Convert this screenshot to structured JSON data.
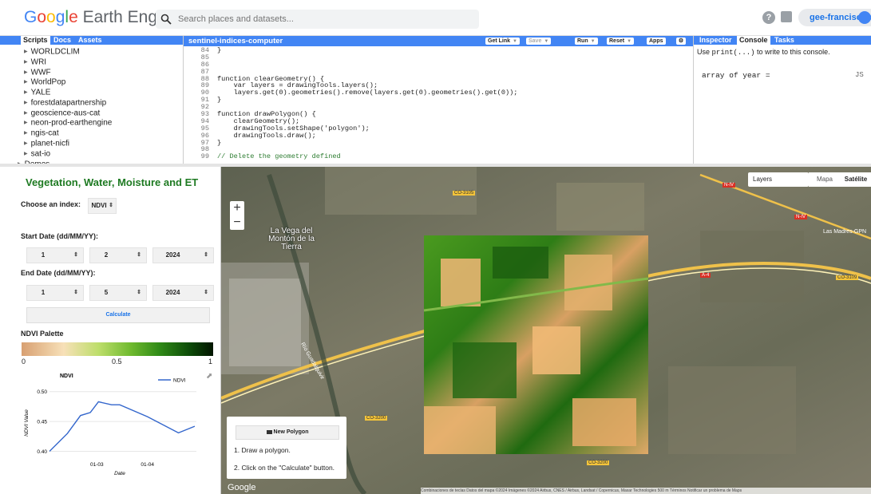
{
  "header": {
    "logo_google": "Google",
    "logo_rest": "Earth Engine",
    "search_placeholder": "Search places and datasets...",
    "help_label": "?",
    "user": "gee-franciscopuig"
  },
  "left_panel": {
    "tabs": [
      "Scripts",
      "Docs",
      "Assets"
    ],
    "items": [
      "WORLDCLIM",
      "WRI",
      "WWF",
      "WorldPop",
      "YALE",
      "forestdatapartnership",
      "geoscience-aus-cat",
      "neon-prod-earthengine",
      "ngis-cat",
      "planet-nicfi",
      "sat-io",
      "Demos"
    ]
  },
  "editor": {
    "title": "sentinel-indices-computer",
    "buttons": [
      "Get Link",
      "Save",
      "Run",
      "Reset",
      "Apps"
    ],
    "lines": [
      {
        "n": "84",
        "t": "}"
      },
      {
        "n": "85",
        "t": ""
      },
      {
        "n": "86",
        "t": ""
      },
      {
        "n": "87",
        "t": ""
      },
      {
        "n": "88",
        "t": "function clearGeometry() {"
      },
      {
        "n": "89",
        "t": "    var layers = drawingTools.layers();"
      },
      {
        "n": "90",
        "t": "    layers.get(0).geometries().remove(layers.get(0).geometries().get(0));"
      },
      {
        "n": "91",
        "t": "}"
      },
      {
        "n": "92",
        "t": ""
      },
      {
        "n": "93",
        "t": "function drawPolygon() {"
      },
      {
        "n": "94",
        "t": "    clearGeometry();"
      },
      {
        "n": "95",
        "t": "    drawingTools.setShape('polygon');"
      },
      {
        "n": "96",
        "t": "    drawingTools.draw();"
      },
      {
        "n": "97",
        "t": "}"
      },
      {
        "n": "98",
        "t": ""
      },
      {
        "n": "99",
        "t": "// Delete the geometry defined"
      }
    ]
  },
  "right_panel": {
    "tabs": [
      "Inspector",
      "Console",
      "Tasks"
    ],
    "hint_prefix": "Use ",
    "hint_code": "print(...)",
    "hint_suffix": " to write to this console.",
    "console_label": "array of year =",
    "console_value": "JS"
  },
  "ui_panel": {
    "title": "Vegetation, Water, Moisture and ET",
    "index_label": "Choose an index:",
    "index_value": "NDVI",
    "start_label": "Start Date (dd/MM/YY):",
    "start": [
      "1",
      "2",
      "2024"
    ],
    "end_label": "End Date (dd/MM/YY):",
    "end": [
      "1",
      "5",
      "2024"
    ],
    "calculate": "Calculate",
    "palette_label": "NDVI Palette",
    "palette_min": "0",
    "palette_mid": "0.5",
    "palette_max": "1",
    "palette_colors": [
      "#d8a072",
      "#f7e0b8",
      "#bede6b",
      "#6fba2f",
      "#2f8a17",
      "#0c4a08",
      "#021500"
    ]
  },
  "chart_data": {
    "type": "line",
    "title": "NDVI",
    "xlabel": "Date",
    "ylabel": "NDVI Value",
    "series": [
      {
        "name": "NDVI",
        "color": "#3366cc",
        "x": [
          "2024-02-01",
          "2024-02-12",
          "2024-02-20",
          "2024-02-26",
          "2024-03-02",
          "2024-03-10",
          "2024-03-15",
          "2024-04-01",
          "2024-04-20",
          "2024-04-30"
        ],
        "y": [
          0.4,
          0.43,
          0.46,
          0.465,
          0.483,
          0.478,
          0.478,
          0.458,
          0.431,
          0.442
        ]
      }
    ],
    "x_ticks": [
      "01-03",
      "01-04"
    ],
    "y_ticks": [
      "0.40",
      "0.45",
      "0.50"
    ],
    "ylim": [
      0.39,
      0.505
    ],
    "xlim": [
      "2024-02-01",
      "2024-05-01"
    ],
    "legend_position": "top-right"
  },
  "map": {
    "layers_label": "Layers",
    "map_type": "Mapa",
    "satellite": "Satélite",
    "town": "La Vega del Montón de la Tierra",
    "river": "Río Guadalquivir",
    "roads": [
      "CO-3105",
      "N-IV",
      "A-4",
      "CO-3200",
      "CO-3200",
      "N-IV",
      "CO-3109"
    ],
    "place": "Las Madres-GPN",
    "new_polygon": "New Polygon",
    "step1": "1. Draw a polygon.",
    "step2": "2. Click on the \"Calculate\" button.",
    "google": "Google",
    "attribution": "Combinaciones de teclas   Datos del mapa ©2024 Imágenes ©2024 Airbus, CNES / Airbus, Landsat / Copernicus, Maxar Technologies   500 m   Términos   Notificar un problema de Maps",
    "zoom_in": "+",
    "zoom_out": "−"
  }
}
